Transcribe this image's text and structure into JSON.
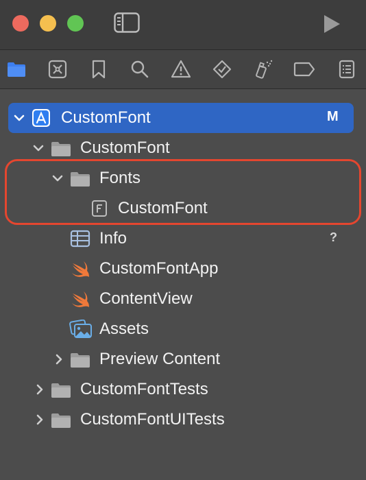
{
  "window": {
    "title_controls": [
      "close",
      "minimize",
      "zoom"
    ]
  },
  "navigator_tabs": [
    {
      "icon": "folder-icon",
      "active": true
    },
    {
      "icon": "source-control-icon"
    },
    {
      "icon": "bookmark-icon"
    },
    {
      "icon": "search-icon"
    },
    {
      "icon": "warning-icon"
    },
    {
      "icon": "test-diamond-icon"
    },
    {
      "icon": "debug-spray-icon"
    },
    {
      "icon": "breakpoint-icon"
    },
    {
      "icon": "report-icon"
    }
  ],
  "tree": {
    "project": {
      "label": "CustomFont",
      "badge": "M"
    },
    "group": {
      "label": "CustomFont"
    },
    "fonts_folder": {
      "label": "Fonts"
    },
    "font_file": {
      "label": "CustomFont"
    },
    "info": {
      "label": "Info",
      "badge": "?"
    },
    "app_file": {
      "label": "CustomFontApp"
    },
    "content_view": {
      "label": "ContentView"
    },
    "assets": {
      "label": "Assets"
    },
    "preview_content": {
      "label": "Preview Content"
    },
    "tests": {
      "label": "CustomFontTests"
    },
    "ui_tests": {
      "label": "CustomFontUITests"
    }
  },
  "colors": {
    "selection": "#2f66c4",
    "highlight": "#e5462f",
    "folder": "#a9a9a9",
    "swift": "#f0793a"
  }
}
